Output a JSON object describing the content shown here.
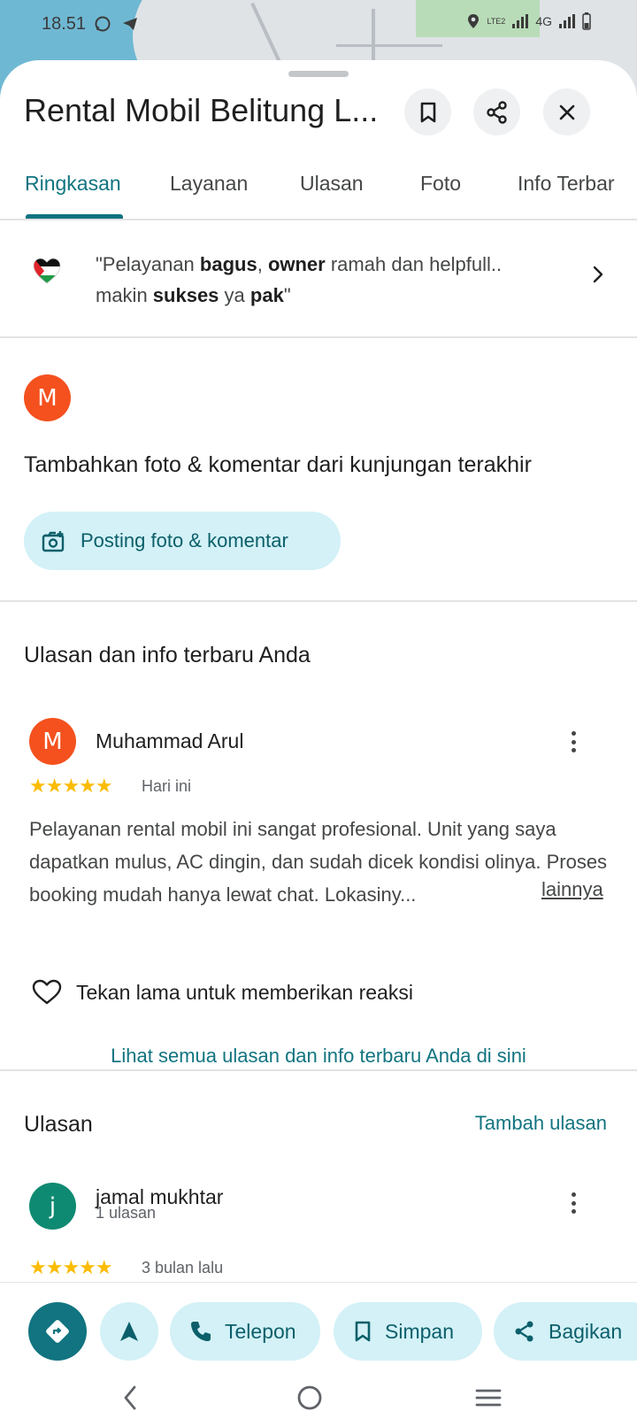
{
  "status_bar": {
    "time": "18.51",
    "network": "4G",
    "lte_label": "LTE2"
  },
  "header": {
    "title": "Rental Mobil Belitung L..."
  },
  "tabs": [
    {
      "label": "Ringkasan",
      "active": true
    },
    {
      "label": "Layanan",
      "active": false
    },
    {
      "label": "Ulasan",
      "active": false
    },
    {
      "label": "Foto",
      "active": false
    },
    {
      "label": "Info Terbar",
      "active": false
    }
  ],
  "highlight": {
    "segments": [
      {
        "text": "\"Pelayanan ",
        "bold": false
      },
      {
        "text": "bagus",
        "bold": true
      },
      {
        "text": ", ",
        "bold": false
      },
      {
        "text": "owner",
        "bold": true
      },
      {
        "text": " ramah dan helpfull.. makin ",
        "bold": false
      },
      {
        "text": "sukses",
        "bold": true
      },
      {
        "text": " ya ",
        "bold": false
      },
      {
        "text": "pak",
        "bold": true
      },
      {
        "text": "\"",
        "bold": false
      }
    ]
  },
  "contribute": {
    "avatar_letter": "M",
    "title": "Tambahkan foto & komentar dari kunjungan terakhir",
    "button_label": "Posting foto & komentar"
  },
  "my_review": {
    "section_title": "Ulasan dan info terbaru Anda",
    "avatar_letter": "M",
    "author": "Muhammad Arul",
    "rating": 5,
    "stars": "★★★★★",
    "date": "Hari ini",
    "text": "Pelayanan rental mobil ini sangat profesional. Unit yang saya dapatkan mulus, AC dingin, dan sudah dicek kondisi olinya. Proses booking mudah hanya lewat chat. Lokasiny...",
    "more_label": "lainnya",
    "react_label": "Tekan lama untuk memberikan reaksi",
    "see_all_label": "Lihat semua ulasan dan info terbaru Anda di sini"
  },
  "reviews": {
    "section_title": "Ulasan",
    "add_label": "Tambah ulasan",
    "items": [
      {
        "avatar_letter": "j",
        "author": "jamal mukhtar",
        "sub": "1 ulasan",
        "rating": 5,
        "stars": "★★★★★",
        "date": "3 bulan lalu"
      }
    ]
  },
  "actions": {
    "call_label": "Telepon",
    "save_label": "Simpan",
    "share_label": "Bagikan"
  },
  "colors": {
    "accent": "#117480",
    "chip_bg": "#d3f1f7",
    "avatar_orange": "#f4511e",
    "avatar_green": "#0f8a72",
    "star": "#fbbc04"
  }
}
